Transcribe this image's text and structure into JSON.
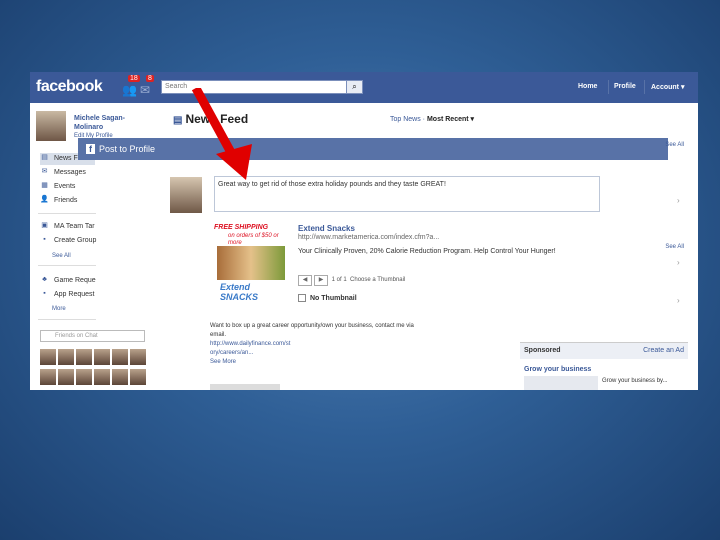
{
  "header": {
    "logo": "facebook",
    "requests_badge": "18",
    "notifications_badge": "8",
    "search_placeholder": "Search",
    "nav": {
      "home": "Home",
      "profile": "Profile",
      "account": "Account ▾"
    }
  },
  "sidebar": {
    "profile_name": "Michele Sagan-Molinaro",
    "edit_profile": "Edit My Profile",
    "items": [
      "News Feed",
      "Messages",
      "Events",
      "Friends"
    ],
    "groups": [
      "MA Team Tar",
      "Create Group"
    ],
    "see_all": "See All",
    "apps": [
      "Game Reque",
      "App Request",
      "More"
    ],
    "chat_search": "Friends on Chat"
  },
  "main": {
    "title": "News Feed",
    "top_news": "Top News",
    "most_recent": "Most Recent ▾",
    "post_bar_label": "Post to Profile",
    "compose_text": "Great way to get rid of those extra holiday pounds and they taste GREAT!",
    "link": {
      "title": "Extend Snacks",
      "url": "http://www.marketamerica.com/index.cfm?a...",
      "description": "Your Clinically Proven, 20% Calorie Reduction Program. Help Control Your Hunger!",
      "page": "1 of 1",
      "choose": "Choose a Thumbnail",
      "no_thumbnail": "No Thumbnail",
      "thumb_text": "FREE SHIPPING",
      "thumb_sub": "on orders of $50 or more",
      "thumb_brand": "Extend SNACKS"
    },
    "feed_lines": [
      "Want to box up a great career opportunity/own your business, contact me via",
      "email.",
      "http://www.dailyfinance.com/st",
      "ory/careers/an...",
      "See More"
    ]
  },
  "right": {
    "see_all_1": "See All",
    "see_all_2": "See All",
    "sponsored": "Sponsored",
    "create_ad": "Create an Ad",
    "ad_title": "Grow your business",
    "ad_desc": "Grow your business by..."
  },
  "colors": {
    "brand": "#3b5998",
    "arrow": "#e00000"
  }
}
